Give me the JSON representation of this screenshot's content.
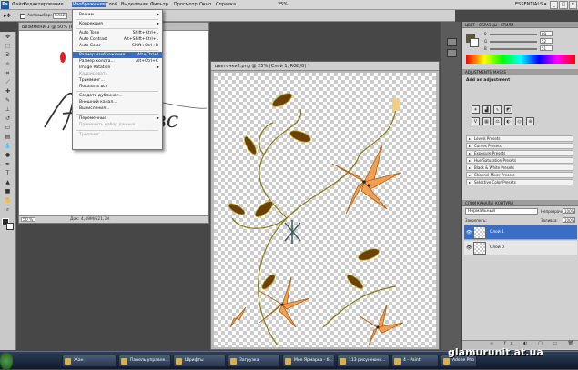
{
  "menubar": {
    "items": [
      "Файл",
      "Редактирование",
      "Изображение",
      "Слой",
      "Выделение",
      "Фильтр",
      "Просмотр",
      "Окно",
      "Справка"
    ],
    "active_index": 2,
    "zoom": "25%",
    "workspace": "ESSENTIALS ▾"
  },
  "options_bar": {
    "auto_select_label": "Автовыбор:",
    "auto_select_value": "Слой"
  },
  "doc1": {
    "tab": "Безимени-1 @ 50% (Рез",
    "zoom": "50 %",
    "status": "Док: 4,49М/621,7К",
    "text_visible": "Л        ловс"
  },
  "doc2": {
    "tab": "цветочки2.png @ 25% (Слой 1, RGB/8) *"
  },
  "image_menu": {
    "items": [
      {
        "label": "Режим",
        "submenu": true
      },
      {
        "sep": true
      },
      {
        "label": "Коррекция",
        "submenu": true
      },
      {
        "sep": true
      },
      {
        "label": "Auto Tone",
        "shortcut": "Shift+Ctrl+L"
      },
      {
        "label": "Auto Contrast",
        "shortcut": "Alt+Shift+Ctrl+L"
      },
      {
        "label": "Auto Color",
        "shortcut": "Shift+Ctrl+B"
      },
      {
        "sep": true
      },
      {
        "label": "Размер изображения...",
        "shortcut": "Alt+Ctrl+I",
        "highlight": true
      },
      {
        "label": "Размер холста...",
        "shortcut": "Alt+Ctrl+C"
      },
      {
        "label": "Image Rotation",
        "submenu": true
      },
      {
        "label": "Кадрировать",
        "disabled": true
      },
      {
        "label": "Тримминг..."
      },
      {
        "label": "Показать все"
      },
      {
        "sep": true
      },
      {
        "label": "Создать дубликат..."
      },
      {
        "label": "Внешний канал..."
      },
      {
        "label": "Вычисления..."
      },
      {
        "sep": true
      },
      {
        "label": "Переменные",
        "submenu": true
      },
      {
        "label": "Применить набор данных...",
        "disabled": true
      },
      {
        "sep": true
      },
      {
        "label": "Треппинг...",
        "disabled": true
      }
    ]
  },
  "color_panel": {
    "tabs": [
      "ЦВЕТ",
      "ОБРАЗЦЫ",
      "СТИЛИ"
    ],
    "r": "89",
    "g": "52",
    "b": "51"
  },
  "adjustments": {
    "tabs": [
      "ADJUSTMENTS",
      "MASKS"
    ],
    "title": "Add an adjustment",
    "presets": [
      "Levels Presets",
      "Curves Presets",
      "Exposure Presets",
      "Hue/Saturation Presets",
      "Black & White Presets",
      "Channel Mixer Presets",
      "Selective Color Presets"
    ]
  },
  "layers": {
    "tabs": [
      "СЛОИ",
      "КАНАЛЫ",
      "КОНТУРЫ"
    ],
    "blend_mode": "Нормальный",
    "opacity_label": "Непрозрачность:",
    "opacity": "100%",
    "lock_label": "Закрепить:",
    "fill_label": "Заливка:",
    "fill": "100%",
    "items": [
      {
        "name": "Слой 1",
        "selected": true
      },
      {
        "name": "Слой 0",
        "selected": false
      }
    ]
  },
  "taskbar": {
    "items": [
      "Жан",
      "Панель управле...",
      "Шрифты",
      "Загрузка",
      "Мое Ярмарка - б...",
      "113 рисунеюно...",
      "4 - Paint",
      "Adobe Pho"
    ]
  },
  "watermark": "glamurunit.at.ua"
}
